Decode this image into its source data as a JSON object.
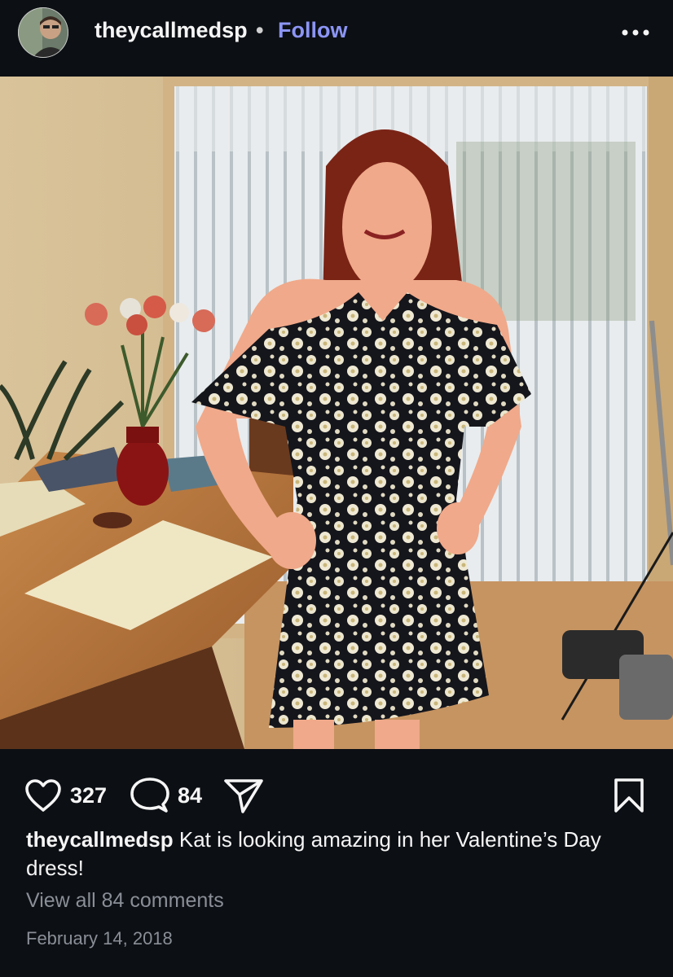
{
  "post": {
    "username": "theycallmedsp",
    "separator": "•",
    "follow_label": "Follow",
    "more_icon": "more-horizontal-icon",
    "likes": "327",
    "comments": "84",
    "caption_user": "theycallmedsp",
    "caption_text": "Kat is looking amazing in her Valentine’s Day dress!",
    "view_comments": "View all 84 comments",
    "date": "February 14, 2018"
  },
  "icons": {
    "like": "heart-icon",
    "comment": "comment-bubble-icon",
    "share": "paper-plane-icon",
    "save": "bookmark-icon"
  },
  "colors": {
    "background": "#0c0f14",
    "follow": "#8c95f5",
    "muted": "#8a8e96",
    "text": "#f5f5f5"
  }
}
